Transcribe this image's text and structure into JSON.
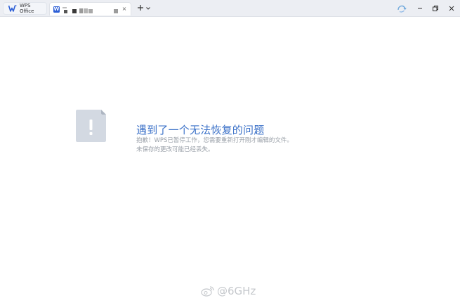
{
  "titlebar": {
    "home_tab_label": "WPS Office",
    "doc_tab_icon_letter": "W",
    "new_tab_symbol": "+",
    "close_symbol": "×"
  },
  "error": {
    "title": "遇到了一个无法恢复的问题",
    "message_line1": "抱歉！WPS已暂停工作，您需要重新打开刚才编辑的文件。",
    "message_line2": "未保存的更改可能已经丢失。"
  },
  "watermark": {
    "text": "@6GHz"
  },
  "colors": {
    "accent": "#3b71c8",
    "brand": "#2d5fd6",
    "titlebar_bg": "#eceef3"
  }
}
